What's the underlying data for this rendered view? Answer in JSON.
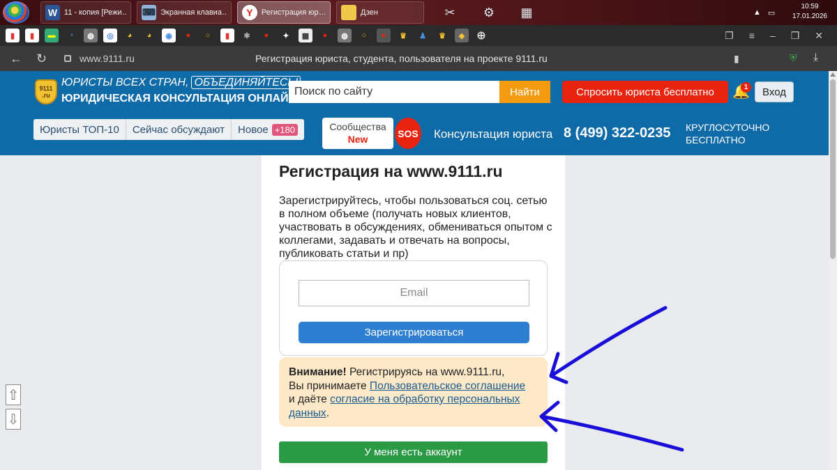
{
  "taskbar": {
    "tasks": [
      {
        "label": "11 - копия [Режи…",
        "icon": "W"
      },
      {
        "label": "Экранная клавиа…",
        "icon": "⌨"
      },
      {
        "label": "Регистрация юр…",
        "icon": "Y"
      },
      {
        "label": "Дзен",
        "icon": "▮"
      }
    ],
    "time": "10:59",
    "date": "17.01.2026"
  },
  "browser": {
    "url": "www.9111.ru",
    "page_title": "Регистрация юриста, студента, пользователя на проекте 9111.ru"
  },
  "header": {
    "logo_text": "9111\n.ru",
    "slogan_part1": "ЮРИСТЫ ВСЕХ СТРАН,",
    "slogan_part2": "ОБЪЕДИНЯЙТЕСЬ!",
    "subtitle": "ЮРИДИЧЕСКАЯ КОНСУЛЬТАЦИЯ ОНЛАЙН",
    "search_placeholder": "Поиск по сайту",
    "search_button": "Найти",
    "ask_button": "Спросить юриста бесплатно",
    "notification_count": "1",
    "login_button": "Вход",
    "nav": {
      "top10": "Юристы ТОП-10",
      "discussing": "Сейчас обсуждают",
      "new": "Новое",
      "new_badge": "+180"
    },
    "communities": "Сообщества",
    "communities_new": "New",
    "sos": "SOS",
    "consult_text": "Консультация юриста",
    "phone": "8 (499) 322-0235",
    "round_clock": "КРУГЛОСУТОЧНО\nБЕСПЛАТНО"
  },
  "registration": {
    "title": "Регистрация на www.9111.ru",
    "intro": "Зарегистрируйтесь, чтобы пользоваться соц. сетью в полном объеме (получать новых клиентов, участвовать в обсуждениях, обмениваться опытом с коллегами, задавать и отвечать на вопросы, публиковать статьи и пр)",
    "email_placeholder": "Email",
    "register_button": "Зарегистрироваться",
    "notice": {
      "bold": "Внимание!",
      "text1": " Регистрируясь на www.9111.ru,",
      "text2": "Вы принимаете ",
      "link1": "Пользовательское соглашение",
      "text3": "и даёте ",
      "link2": "согласие на обработку персональных данных",
      "text4": "."
    },
    "have_account_button": "У меня есть аккаунт"
  },
  "colors": {
    "header_bg": "#0f6aa8",
    "ask_red": "#e8230f",
    "search_orange": "#f39c12",
    "register_blue": "#2e7fd1",
    "account_green": "#2a9a45",
    "notice_bg": "#fde9c8",
    "annotation_arrow": "#1a0fd8"
  }
}
